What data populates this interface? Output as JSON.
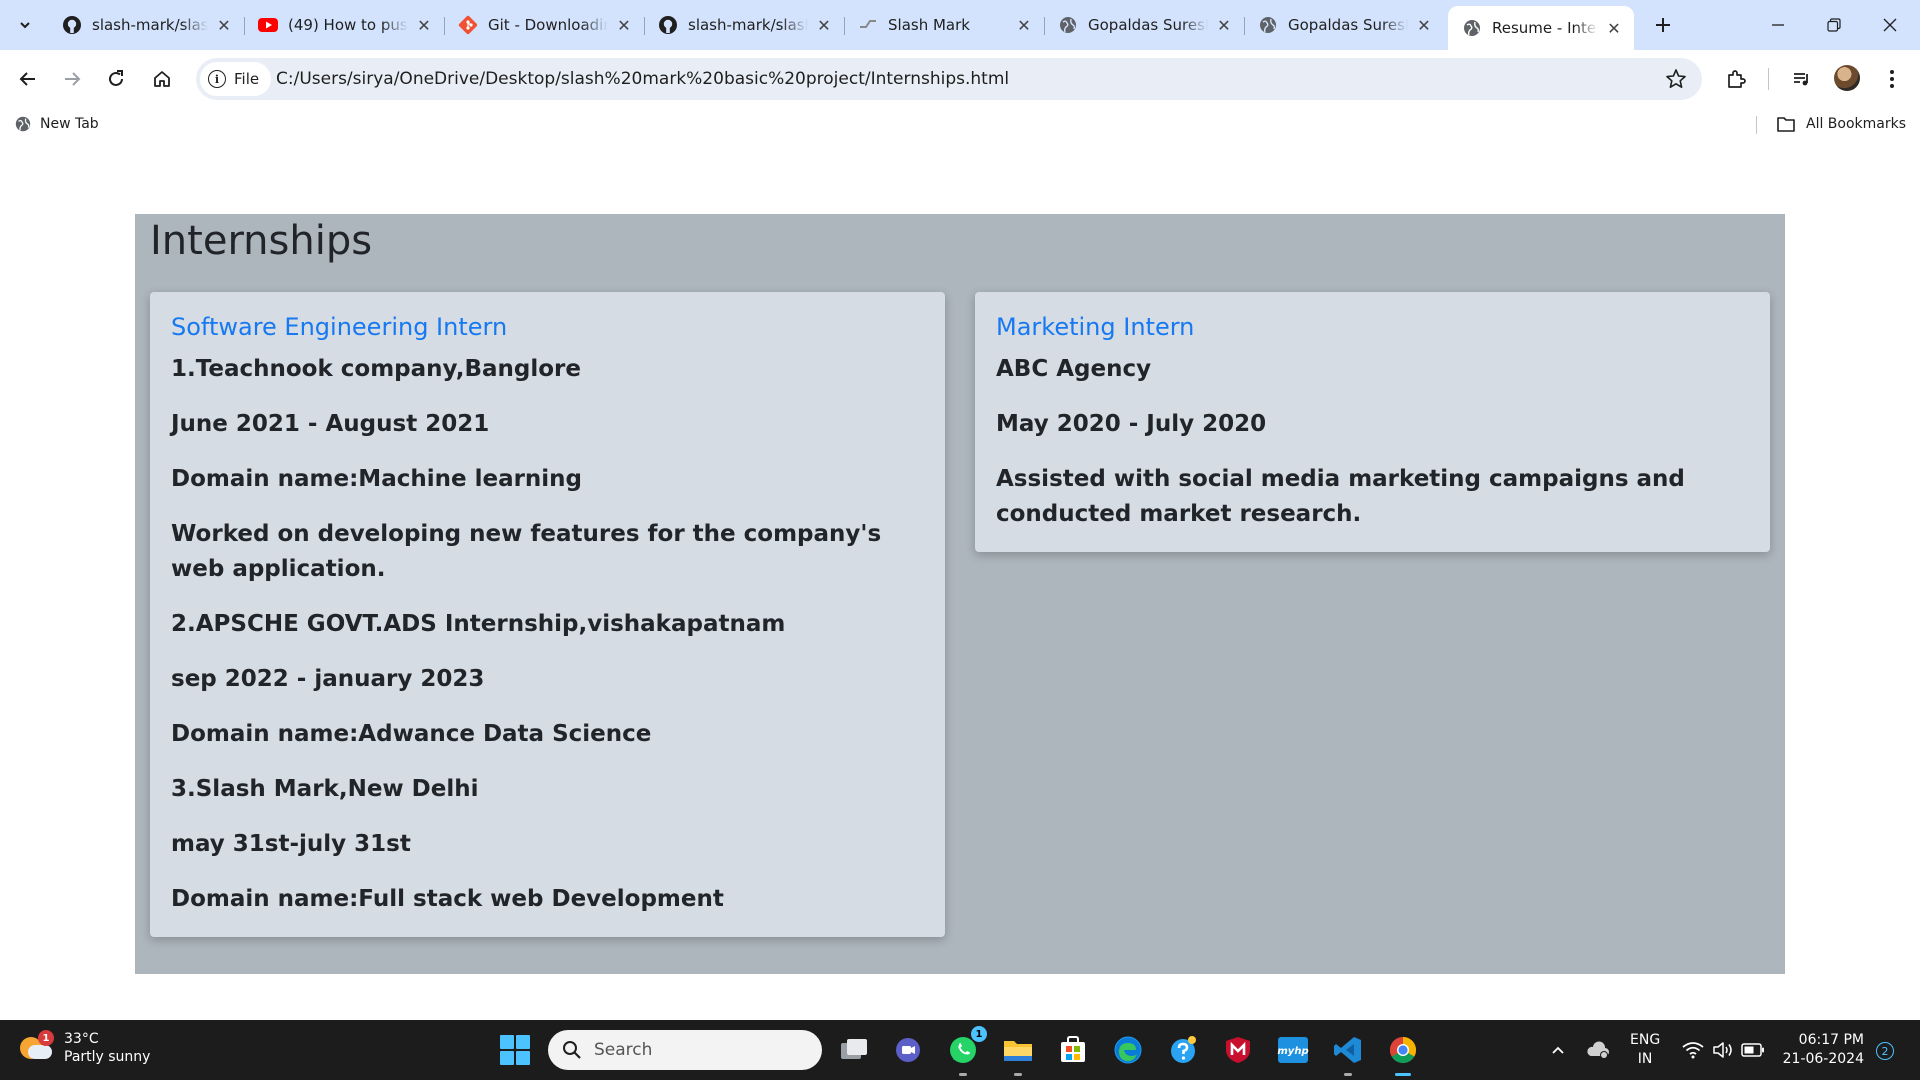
{
  "browser": {
    "tabs": [
      {
        "title": "slash-mark/slash",
        "icon": "github-icon"
      },
      {
        "title": "(49) How to push",
        "icon": "youtube-icon"
      },
      {
        "title": "Git - Downloading",
        "icon": "git-icon"
      },
      {
        "title": "slash-mark/slash",
        "icon": "github-icon"
      },
      {
        "title": "Slash Mark",
        "icon": "slashmark-icon"
      },
      {
        "title": "Gopaldas Suresh",
        "icon": "globe-icon"
      },
      {
        "title": "Gopaldas Suresh",
        "icon": "globe-icon"
      },
      {
        "title": "Resume - Interns",
        "icon": "globe-icon",
        "active": true
      }
    ],
    "site_chip": "File",
    "url": "C:/Users/sirya/OneDrive/Desktop/slash%20mark%20basic%20project/Internships.html",
    "bookmarks": {
      "new_tab": "New Tab",
      "all_bookmarks": "All Bookmarks"
    }
  },
  "page": {
    "heading": "Internships",
    "cards": [
      {
        "title": "Software Engineering Intern",
        "lines": [
          "1.Teachnook company,Banglore",
          "June 2021 - August 2021",
          "Domain name:Machine learning",
          "Worked on developing new features for the company's web application.",
          "2.APSCHE GOVT.ADS Internship,vishakapatnam",
          "sep 2022 - january 2023",
          "Domain name:Adwance Data Science",
          "3.Slash Mark,New Delhi",
          "may 31st-july 31st",
          "Domain name:Full stack web Development"
        ]
      },
      {
        "title": "Marketing Intern",
        "lines": [
          "ABC Agency",
          "May 2020 - July 2020",
          "Assisted with social media marketing campaigns and conducted market research."
        ]
      }
    ],
    "colors": {
      "section_bg": "#adb5bd",
      "card_bg": "#d6dce3",
      "card_title": "#1779f2"
    }
  },
  "taskbar": {
    "weather": {
      "temp": "33°C",
      "condition": "Partly sunny",
      "badge": "1"
    },
    "search_placeholder": "Search",
    "whatsapp_badge": "1",
    "lang_line1": "ENG",
    "lang_line2": "IN",
    "time": "06:17 PM",
    "date": "21-06-2024",
    "notification_count": "2"
  }
}
